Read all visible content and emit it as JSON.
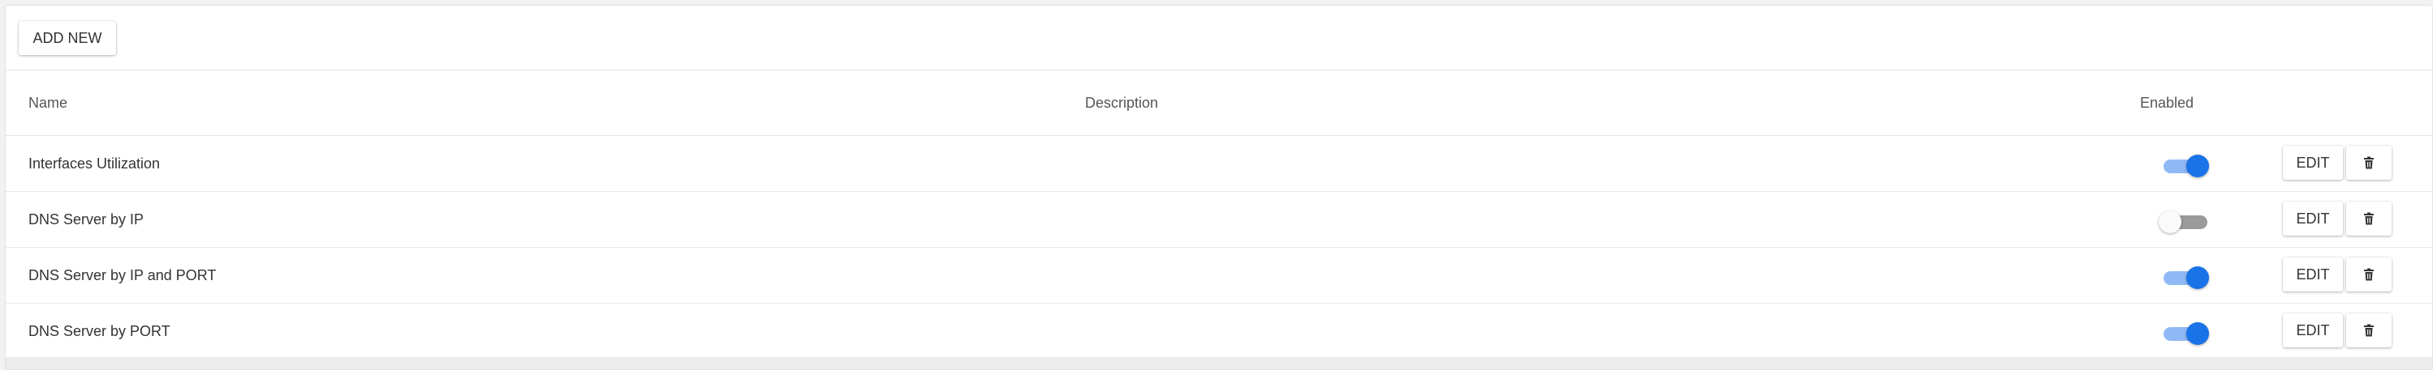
{
  "toolbar": {
    "add_label": "ADD NEW"
  },
  "table": {
    "columns": {
      "name": "Name",
      "description": "Description",
      "enabled": "Enabled"
    },
    "rows": [
      {
        "name": "Interfaces Utilization",
        "description": "",
        "enabled": true
      },
      {
        "name": "DNS Server by IP",
        "description": "",
        "enabled": false
      },
      {
        "name": "DNS Server by IP and PORT",
        "description": "",
        "enabled": true
      },
      {
        "name": "DNS Server by PORT",
        "description": "",
        "enabled": true
      }
    ],
    "edit_label": "EDIT",
    "delete_icon": "trash-icon"
  },
  "colors": {
    "toggle_on": "#1a73e8",
    "toggle_on_track": "#8fb9f5",
    "toggle_off_track": "#9a9a9a"
  }
}
